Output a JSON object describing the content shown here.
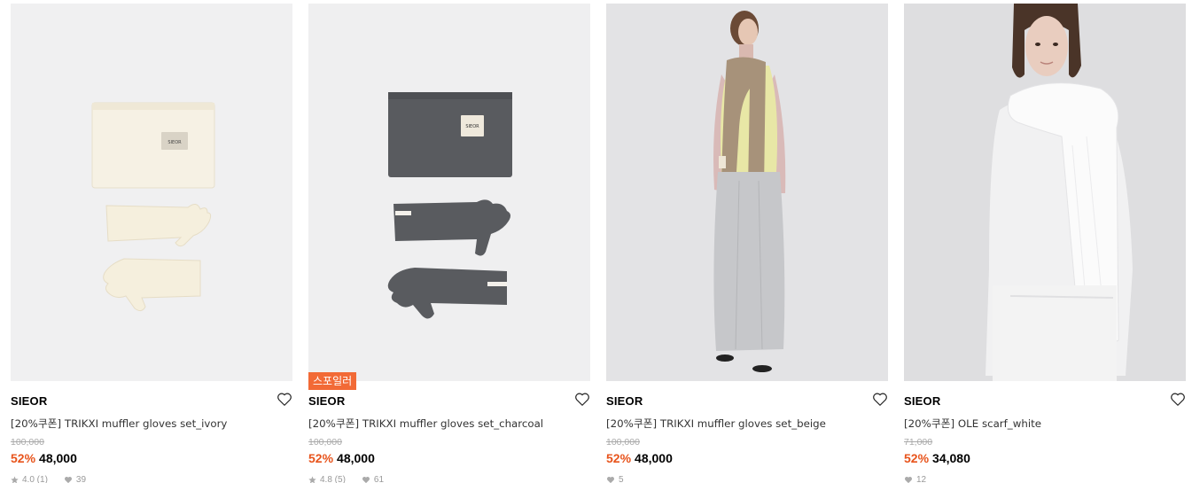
{
  "products": [
    {
      "brand": "SIEOR",
      "name": "[20%쿠폰] TRIKXI muffler gloves set_ivory",
      "original_price": "100,000",
      "discount": "52%",
      "price": "48,000",
      "rating": "4.0 (1)",
      "likes": "39",
      "badge": "",
      "label_text": "SIEOR"
    },
    {
      "brand": "SIEOR",
      "name": "[20%쿠폰] TRIKXI muffler gloves set_charcoal",
      "original_price": "100,000",
      "discount": "52%",
      "price": "48,000",
      "rating": "4.8 (5)",
      "likes": "61",
      "badge": "스포일러",
      "label_text": "SIEOR"
    },
    {
      "brand": "SIEOR",
      "name": "[20%쿠폰] TRIKXI muffler gloves set_beige",
      "original_price": "100,000",
      "discount": "52%",
      "price": "48,000",
      "rating": "",
      "likes": "5",
      "badge": ""
    },
    {
      "brand": "SIEOR",
      "name": "[20%쿠폰] OLE scarf_white",
      "original_price": "71,000",
      "discount": "52%",
      "price": "34,080",
      "rating": "",
      "likes": "12",
      "badge": ""
    }
  ],
  "colors": {
    "discount": "#e8541c",
    "badge_bg": "#f26a36",
    "ivory": "#f6f1e4",
    "charcoal": "#55575b",
    "photo_bg": "#e9e9eb"
  },
  "icons": {
    "wishlist": "heart-outline-icon",
    "rating": "star-icon",
    "likes": "heart-filled-icon"
  }
}
